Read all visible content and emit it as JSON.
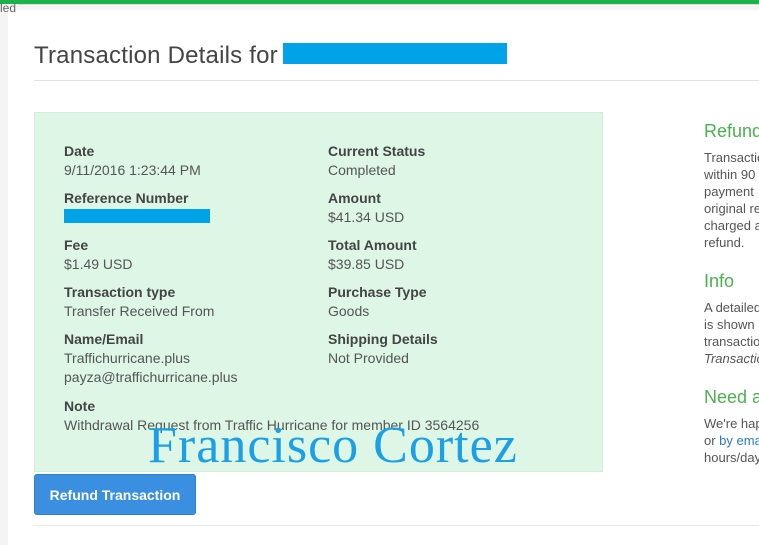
{
  "header": {
    "cut_off_text": "led",
    "title": "Transaction Details for"
  },
  "details": {
    "date": {
      "label": "Date",
      "value": "9/11/2016 1:23:44 PM"
    },
    "current_status": {
      "label": "Current Status",
      "value": "Completed"
    },
    "reference_number": {
      "label": "Reference Number"
    },
    "amount": {
      "label": "Amount",
      "value": "$41.34 USD"
    },
    "fee": {
      "label": "Fee",
      "value": "$1.49 USD"
    },
    "total_amount": {
      "label": "Total Amount",
      "value": "$39.85 USD"
    },
    "transaction_type": {
      "label": "Transaction type",
      "value": "Transfer Received From"
    },
    "purchase_type": {
      "label": "Purchase Type",
      "value": "Goods"
    },
    "name_email": {
      "label": "Name/Email",
      "name": "Traffichurricane.plus",
      "email": "payza@traffichurricane.plus"
    },
    "shipping_details": {
      "label": "Shipping Details",
      "value": "Not Provided"
    },
    "note": {
      "label": "Note",
      "value": "Withdrawal Request from Traffic Hurricane for member ID 3564256"
    }
  },
  "signature_text": "Francisco Cortez",
  "refund_button": {
    "label": "Refund Transaction"
  },
  "sidebar": {
    "refund": {
      "heading": "Refund",
      "lines": [
        "Transactio",
        "within 90",
        "payment",
        "original re",
        "charged a",
        "refund."
      ]
    },
    "info": {
      "heading": "Info",
      "lines": [
        "A detailed",
        "is shown",
        "transactio"
      ],
      "italic_line": "Transactio"
    },
    "need_help": {
      "heading": "Need a",
      "line1": "We're hap",
      "line2_prefix": "or ",
      "line2_link": "by ema",
      "line3": "hours/day"
    }
  },
  "colors": {
    "top_bar": "#19b34a",
    "details_bg": "#ddf6e6",
    "redaction": "#00a2e8",
    "button": "#3b8fe0",
    "sidebar_heading": "#4caf50"
  }
}
